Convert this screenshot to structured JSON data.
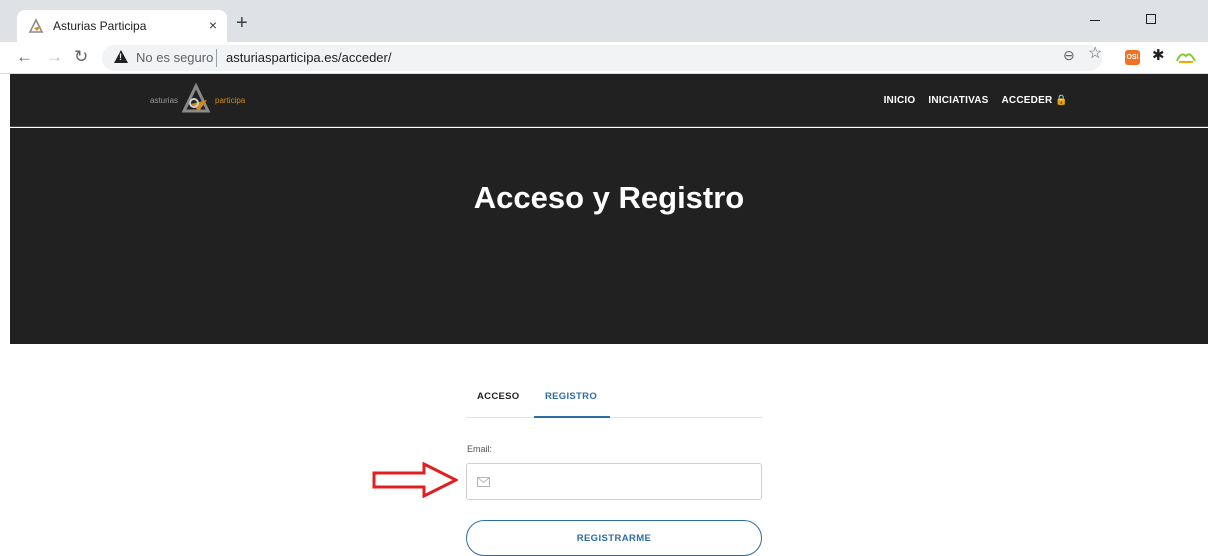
{
  "browser": {
    "tab_title": "Asturias Participa",
    "close_glyph": "×",
    "new_tab_glyph": "+",
    "insecure_label": "No es seguro",
    "url": "asturiasparticipa.es/acceder/",
    "icons": [
      "back-arrow-icon",
      "forward-arrow-icon",
      "reload-icon",
      "warning-icon",
      "zoom-icon",
      "star-icon",
      "puzzle-icon"
    ]
  },
  "header": {
    "logo_left": "asturias",
    "logo_right": "participa",
    "nav": [
      {
        "label": "INICIO"
      },
      {
        "label": "INICIATIVAS"
      },
      {
        "label": "ACCEDER 🔒"
      }
    ]
  },
  "hero": {
    "title": "Acceso y Registro"
  },
  "auth": {
    "tabs": [
      {
        "label": "ACCESO"
      },
      {
        "label": "REGISTRO"
      }
    ],
    "email_label": "Email:",
    "email_value": "",
    "submit_label": "REGISTRARME"
  },
  "colors": {
    "accent": "#2e6da4",
    "header_bg": "#212121",
    "annotation_arrow": "#e02020",
    "logo_orange": "#d08a1e"
  }
}
